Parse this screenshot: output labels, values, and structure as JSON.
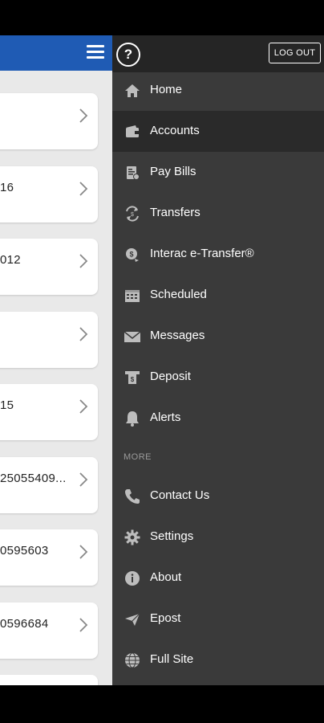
{
  "header": {
    "help_label": "?",
    "logout_label": "LOG OUT"
  },
  "accounts": [
    {
      "number": ""
    },
    {
      "number": "16"
    },
    {
      "number": "012"
    },
    {
      "number": ""
    },
    {
      "number": "15"
    },
    {
      "number": "25055409..."
    },
    {
      "number": "0595603"
    },
    {
      "number": "0596684"
    }
  ],
  "menu": {
    "items": [
      {
        "label": "Home",
        "icon": "home-icon"
      },
      {
        "label": "Accounts",
        "icon": "wallet-icon"
      },
      {
        "label": "Pay Bills",
        "icon": "pay-bills-icon"
      },
      {
        "label": "Transfers",
        "icon": "transfers-icon"
      },
      {
        "label": "Interac e-Transfer®",
        "icon": "etransfer-icon"
      },
      {
        "label": "Scheduled",
        "icon": "calendar-icon"
      },
      {
        "label": "Messages",
        "icon": "envelope-icon"
      },
      {
        "label": "Deposit",
        "icon": "deposit-icon"
      },
      {
        "label": "Alerts",
        "icon": "bell-icon"
      }
    ],
    "more_heading": "MORE",
    "more_items": [
      {
        "label": "Contact Us",
        "icon": "phone-icon"
      },
      {
        "label": "Settings",
        "icon": "gear-icon"
      },
      {
        "label": "About",
        "icon": "info-icon"
      },
      {
        "label": "Epost",
        "icon": "paper-plane-icon"
      },
      {
        "label": "Full Site",
        "icon": "globe-icon"
      }
    ]
  },
  "colors": {
    "header_blue": "#1f5bb4",
    "drawer_bg": "#3a3a3a",
    "drawer_top": "#252525",
    "active_bg": "#2a2a2a",
    "icon_gray": "#bdbdbd"
  }
}
